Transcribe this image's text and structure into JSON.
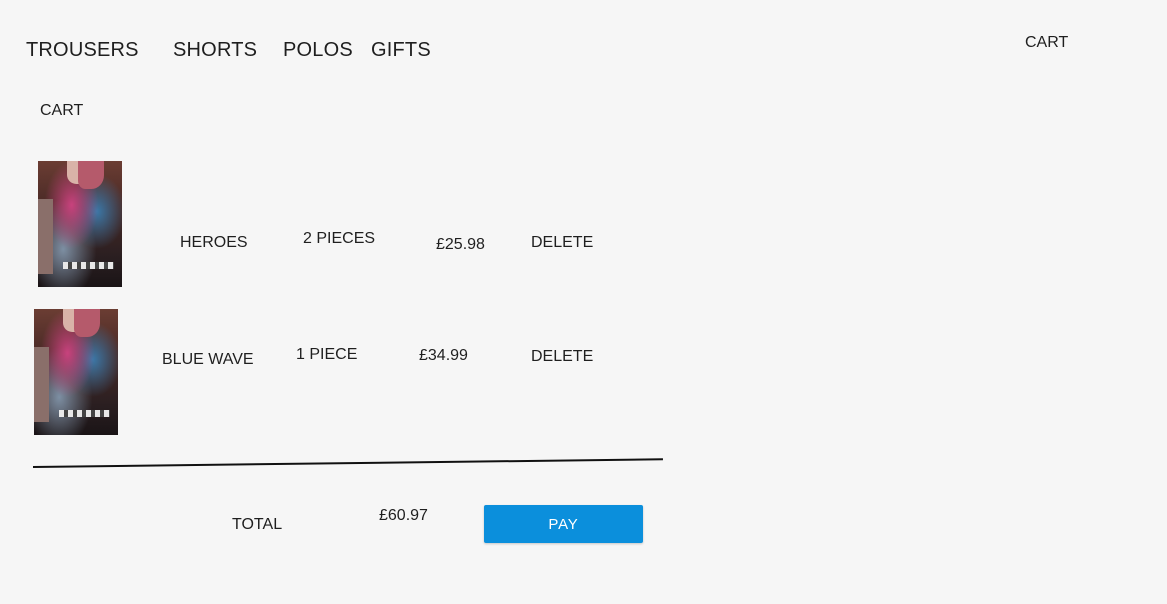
{
  "nav": {
    "items": [
      {
        "label": "TROUSERS"
      },
      {
        "label": "SHORTS"
      },
      {
        "label": "POLOS"
      },
      {
        "label": "GIFTS"
      }
    ],
    "cart_label": "CART"
  },
  "cart": {
    "title": "CART",
    "items": [
      {
        "name": "HEROES",
        "quantity": "2 PIECES",
        "price": "£25.98",
        "delete_label": "DELETE"
      },
      {
        "name": "BLUE WAVE",
        "quantity": "1 PIECE",
        "price": "£34.99",
        "delete_label": "DELETE"
      }
    ],
    "total_label": "TOTAL",
    "total_value": "£60.97",
    "pay_label": "PAY"
  },
  "colors": {
    "background": "#f6f6f6",
    "pay_button": "#0b8fdc",
    "text": "#1f1f1f"
  }
}
